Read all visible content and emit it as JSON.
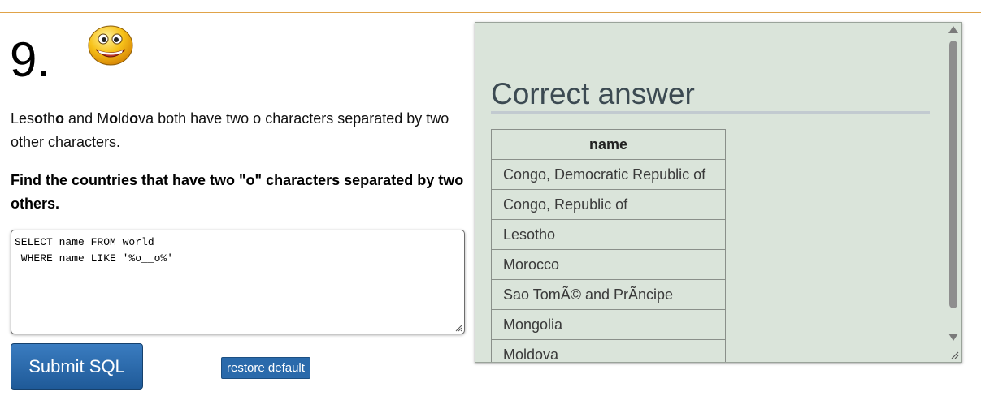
{
  "question": {
    "number": "9.",
    "description_parts": [
      "Les",
      "o",
      "th",
      "o",
      " and M",
      "o",
      "ld",
      "o",
      "va both have two o characters separated by two other characters."
    ],
    "task": "Find the countries that have two \"o\" characters separated by two others."
  },
  "editor": {
    "sql": "SELECT name FROM world\n WHERE name LIKE '%o__o%'"
  },
  "buttons": {
    "submit_label": "Submit SQL",
    "restore_label": "restore default"
  },
  "answer": {
    "title": "Correct answer",
    "column_header": "name",
    "rows": [
      "Congo, Democratic Republic of",
      "Congo, Republic of",
      "Lesotho",
      "Morocco",
      "Sao TomÃ© and PrÃncipe",
      "Mongolia",
      "Moldova"
    ]
  },
  "icons": {
    "smiley": "smiley-face-icon",
    "scroll_up": "scroll-up-arrow-icon",
    "scroll_down": "scroll-down-arrow-icon",
    "resize": "resize-grip-icon"
  },
  "colors": {
    "accent_rule": "#e0a349",
    "submit_button": "#2a6aab",
    "answer_panel_bg": "#dae4da",
    "answer_title": "#3c4a52"
  }
}
